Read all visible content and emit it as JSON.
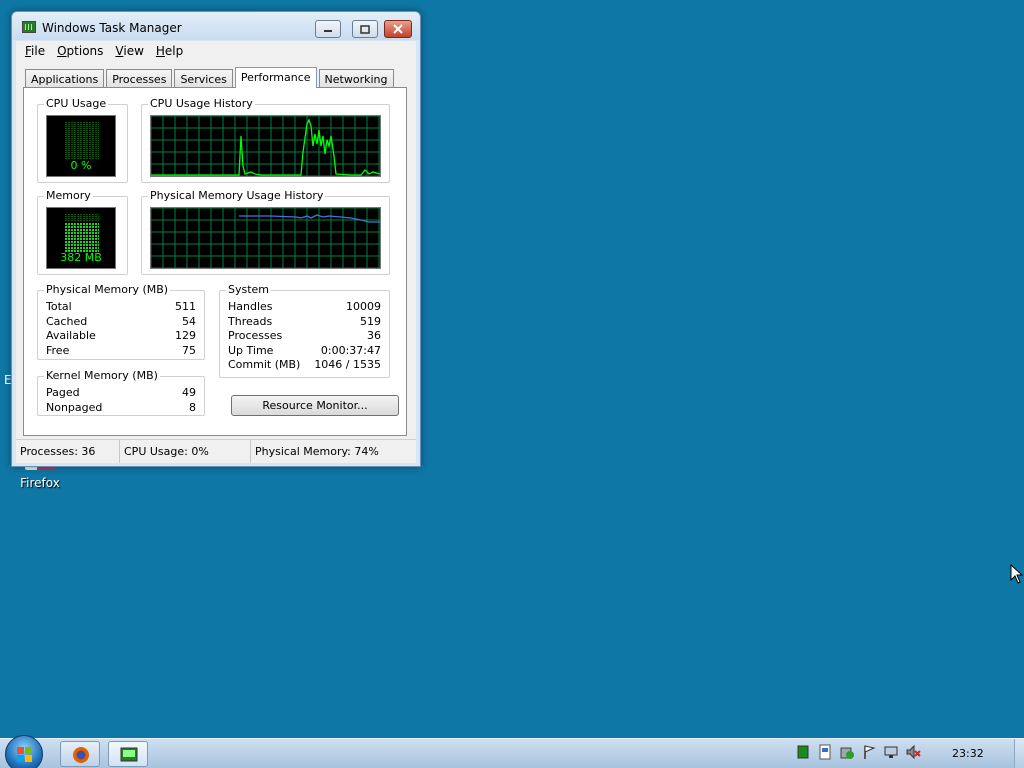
{
  "desktop": {
    "firefox_label": "Firefox",
    "edge_text": "E"
  },
  "window": {
    "title": "Windows Task Manager",
    "menu": [
      {
        "label": "File",
        "key": "F",
        "rest": "ile"
      },
      {
        "label": "Options",
        "key": "O",
        "rest": "ptions"
      },
      {
        "label": "View",
        "key": "V",
        "rest": "iew"
      },
      {
        "label": "Help",
        "key": "H",
        "rest": "elp"
      }
    ],
    "tabs": [
      "Applications",
      "Processes",
      "Services",
      "Performance",
      "Networking"
    ],
    "active_tab": "Performance"
  },
  "performance": {
    "cpu_usage": {
      "title": "CPU Usage",
      "value": "0 %"
    },
    "cpu_history": {
      "title": "CPU Usage History"
    },
    "memory": {
      "title": "Memory",
      "value": "382 MB"
    },
    "memory_history": {
      "title": "Physical Memory Usage History"
    },
    "physical_memory": {
      "title": "Physical Memory (MB)",
      "rows": [
        {
          "label": "Total",
          "value": "511"
        },
        {
          "label": "Cached",
          "value": "54"
        },
        {
          "label": "Available",
          "value": "129"
        },
        {
          "label": "Free",
          "value": "75"
        }
      ]
    },
    "kernel_memory": {
      "title": "Kernel Memory (MB)",
      "rows": [
        {
          "label": "Paged",
          "value": "49"
        },
        {
          "label": "Nonpaged",
          "value": "8"
        }
      ]
    },
    "system": {
      "title": "System",
      "rows": [
        {
          "label": "Handles",
          "value": "10009"
        },
        {
          "label": "Threads",
          "value": "519"
        },
        {
          "label": "Processes",
          "value": "36"
        },
        {
          "label": "Up Time",
          "value": "0:00:37:47"
        },
        {
          "label": "Commit (MB)",
          "value": "1046 / 1535"
        }
      ]
    },
    "resource_monitor_label": "Resource Monitor..."
  },
  "statusbar": {
    "processes": "Processes: 36",
    "cpu": "CPU Usage: 0%",
    "memory": "Physical Memory: 74%"
  },
  "taskbar": {
    "clock": "23:32"
  },
  "colors": {
    "desktop": "#0f77a5",
    "graph_grid": "#008040",
    "graph_line": "#00ff00",
    "memory_line": "#3c78d8"
  }
}
